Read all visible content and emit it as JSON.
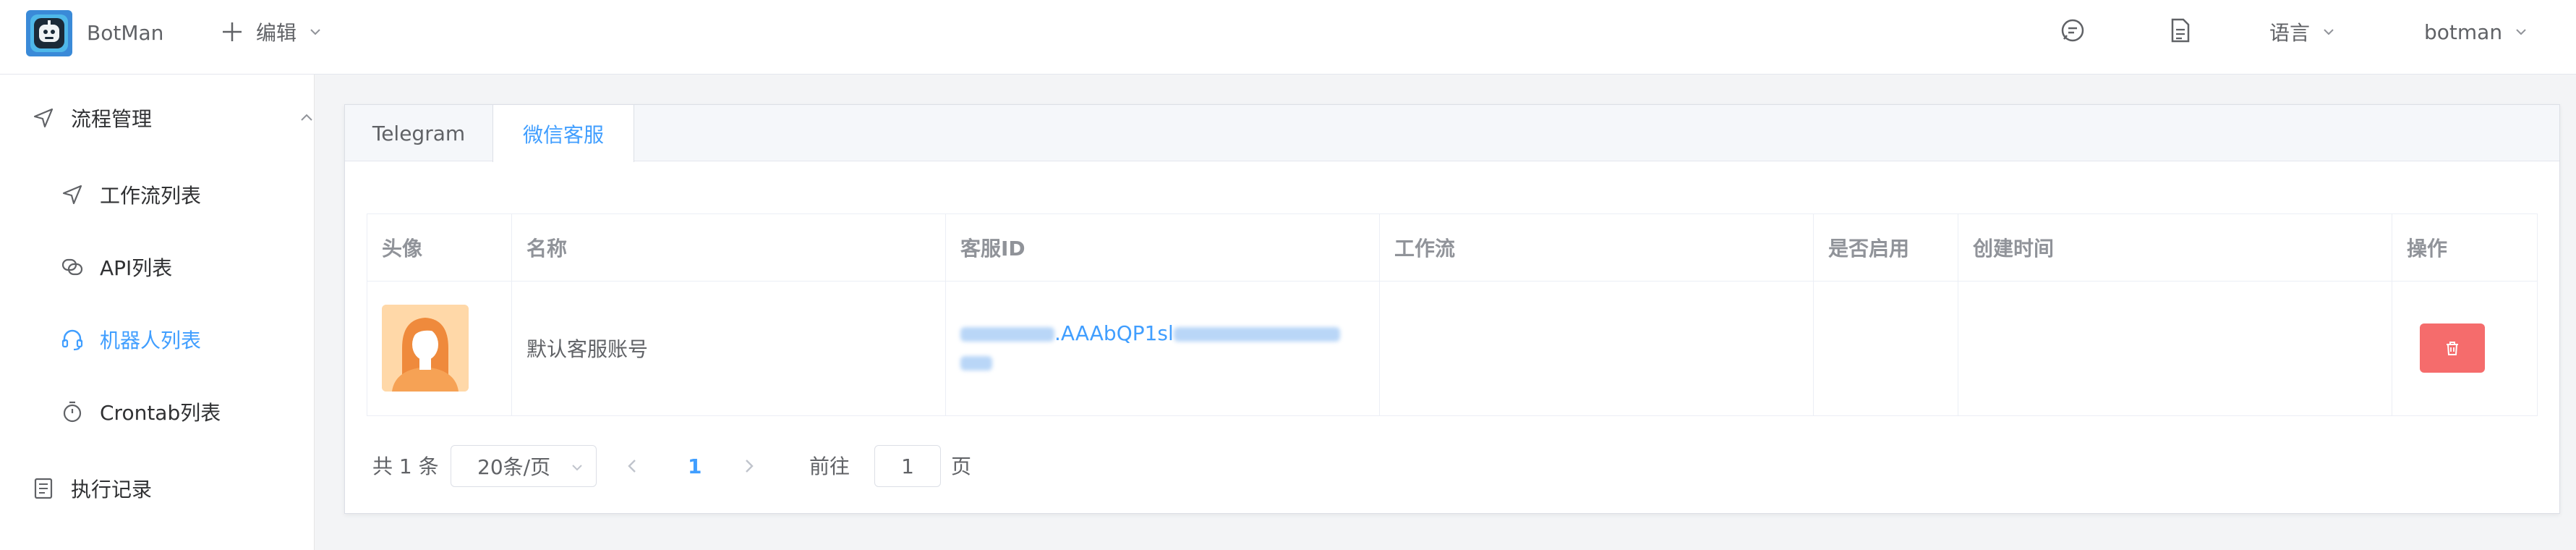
{
  "header": {
    "app_name": "BotMan",
    "edit_label": "编辑",
    "language_label": "语言",
    "user_label": "botman"
  },
  "sidebar": {
    "items": [
      {
        "label": "流程管理",
        "icon": "navigation-icon"
      },
      {
        "label": "工作流列表",
        "icon": "navigation-icon"
      },
      {
        "label": "API列表",
        "icon": "link-icon"
      },
      {
        "label": "机器人列表",
        "icon": "headset-icon"
      },
      {
        "label": "Crontab列表",
        "icon": "timer-icon"
      },
      {
        "label": "执行记录",
        "icon": "document-icon"
      }
    ]
  },
  "tabs": [
    {
      "label": "Telegram"
    },
    {
      "label": "微信客服"
    }
  ],
  "table": {
    "headers": [
      "头像",
      "名称",
      "客服ID",
      "工作流",
      "是否启用",
      "创建时间",
      "操作"
    ],
    "rows": [
      {
        "name": "默认客服账号",
        "id_visible": ".AAAbQP1sl",
        "workflow": "",
        "enabled": "",
        "created": ""
      }
    ]
  },
  "pagination": {
    "total": "共 1 条",
    "page_size": "20条/页",
    "current": "1",
    "goto_label": "前往",
    "goto_value": "1",
    "page_suffix": "页"
  },
  "colors": {
    "accent": "#409eff",
    "danger": "#f56c6c",
    "text": "#303133",
    "muted": "#909399"
  }
}
